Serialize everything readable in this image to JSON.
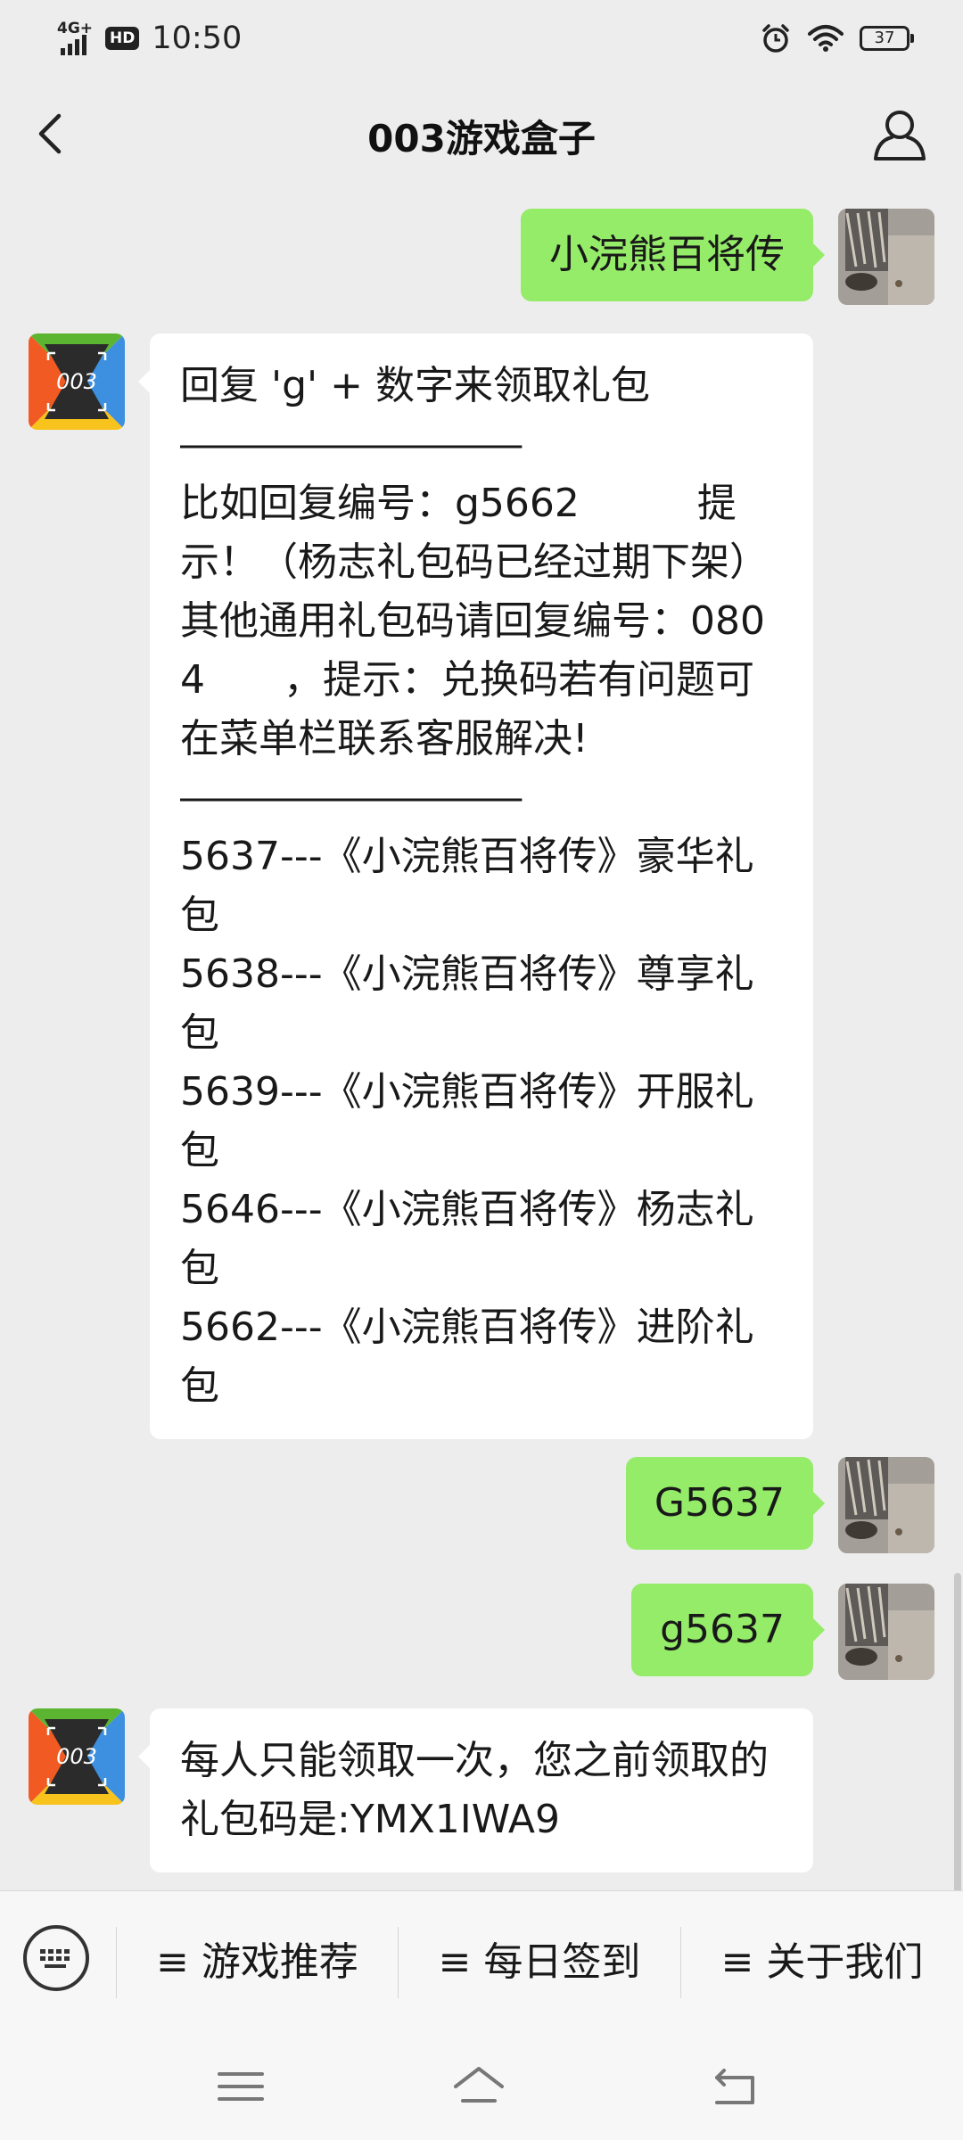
{
  "status": {
    "network": "4G+",
    "hd": "HD",
    "time": "10:50",
    "battery": "37",
    "icons": [
      "signal-icon",
      "alarm-icon",
      "wifi-icon",
      "battery-icon"
    ]
  },
  "header": {
    "title": "003游戏盒子",
    "icons": [
      "back-arrow-icon",
      "profile-icon"
    ]
  },
  "messages": {
    "m1": {
      "text": "小浣熊百将传"
    },
    "m2": {
      "avatar": "003",
      "line1": "回复 'g' + 数字来领取礼包",
      "dash1": "———————————————",
      "line2": "比如回复编号：g5662　　　提示！（杨志礼包码已经过期下架）其他通用礼包码请回复编号：0804　　，提示：兑换码若有问题可在菜单栏联系客服解决!",
      "dash2": "———————————————",
      "gifts": [
        "5637---《小浣熊百将传》豪华礼包",
        "5638---《小浣熊百将传》尊享礼包",
        "5639---《小浣熊百将传》开服礼包",
        "5646---《小浣熊百将传》杨志礼包",
        "5662---《小浣熊百将传》进阶礼包"
      ]
    },
    "m3": {
      "text": "G5637"
    },
    "m4": {
      "text": "g5637"
    },
    "m5": {
      "avatar": "003",
      "text": "每人只能领取一次，您之前领取的礼包码是:YMX1IWA9"
    }
  },
  "menu": {
    "keyboard_icon": "keyboard-icon",
    "items": [
      "≡ 游戏推荐",
      "≡ 每日签到",
      "≡ 关于我们"
    ]
  },
  "nav": {
    "icons": [
      "menu-icon",
      "home-icon",
      "back-icon"
    ]
  },
  "colors": {
    "background": "#ededed",
    "outgoing_bubble": "#95ec69",
    "incoming_bubble": "#ffffff",
    "logo_orange": "#f15a22",
    "logo_green": "#5cb531",
    "logo_blue": "#3d8fe0",
    "logo_yellow": "#f7c31c"
  }
}
